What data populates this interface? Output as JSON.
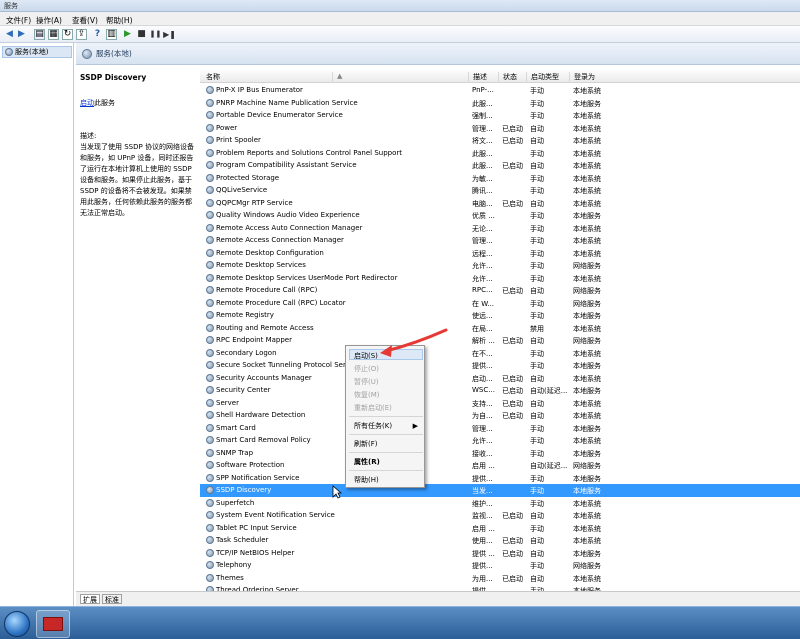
{
  "window": {
    "title": "服务"
  },
  "menu": [
    "文件(F)",
    "操作(A)",
    "查看(V)",
    "帮助(H)"
  ],
  "tree": {
    "item": "服务(本地)"
  },
  "header": {
    "title": "服务(本地)"
  },
  "detail": {
    "name": "SSDP Discovery",
    "start_link": "启动",
    "start_suffix": "此服务",
    "desc_label": "描述:",
    "desc_text": "当发现了使用 SSDP 协议的网络设备和服务，如 UPnP 设备，同时还报告了运行在本地计算机上使用的 SSDP 设备和服务。如果停止此服务，基于 SSDP 的设备将不会被发现。如果禁用此服务，任何依赖此服务的服务都无法正常启动。"
  },
  "columns": {
    "name": "名称",
    "desc": "描述",
    "status": "状态",
    "startup": "启动类型",
    "logon": "登录为"
  },
  "services": [
    {
      "name": "PnP-X IP Bus Enumerator",
      "desc": "PnP-...",
      "status": "",
      "startup": "手动",
      "logon": "本地系统"
    },
    {
      "name": "PNRP Machine Name Publication Service",
      "desc": "此服...",
      "status": "",
      "startup": "手动",
      "logon": "本地服务"
    },
    {
      "name": "Portable Device Enumerator Service",
      "desc": "强制...",
      "status": "",
      "startup": "手动",
      "logon": "本地系统"
    },
    {
      "name": "Power",
      "desc": "管理...",
      "status": "已启动",
      "startup": "自动",
      "logon": "本地系统"
    },
    {
      "name": "Print Spooler",
      "desc": "将文...",
      "status": "已启动",
      "startup": "自动",
      "logon": "本地系统"
    },
    {
      "name": "Problem Reports and Solutions Control Panel Support",
      "desc": "此服...",
      "status": "",
      "startup": "手动",
      "logon": "本地系统"
    },
    {
      "name": "Program Compatibility Assistant Service",
      "desc": "此服...",
      "status": "已启动",
      "startup": "自动",
      "logon": "本地系统"
    },
    {
      "name": "Protected Storage",
      "desc": "为敏...",
      "status": "",
      "startup": "手动",
      "logon": "本地系统"
    },
    {
      "name": "QQLiveService",
      "desc": "腾讯...",
      "status": "",
      "startup": "手动",
      "logon": "本地系统"
    },
    {
      "name": "QQPCMgr RTP Service",
      "desc": "电脑...",
      "status": "已启动",
      "startup": "自动",
      "logon": "本地系统"
    },
    {
      "name": "Quality Windows Audio Video Experience",
      "desc": "优质 ...",
      "status": "",
      "startup": "手动",
      "logon": "本地服务"
    },
    {
      "name": "Remote Access Auto Connection Manager",
      "desc": "无论...",
      "status": "",
      "startup": "手动",
      "logon": "本地系统"
    },
    {
      "name": "Remote Access Connection Manager",
      "desc": "管理...",
      "status": "",
      "startup": "手动",
      "logon": "本地系统"
    },
    {
      "name": "Remote Desktop Configuration",
      "desc": "远程...",
      "status": "",
      "startup": "手动",
      "logon": "本地系统"
    },
    {
      "name": "Remote Desktop Services",
      "desc": "允许...",
      "status": "",
      "startup": "手动",
      "logon": "网络服务"
    },
    {
      "name": "Remote Desktop Services UserMode Port Redirector",
      "desc": "允许...",
      "status": "",
      "startup": "手动",
      "logon": "本地系统"
    },
    {
      "name": "Remote Procedure Call (RPC)",
      "desc": "RPC...",
      "status": "已启动",
      "startup": "自动",
      "logon": "网络服务"
    },
    {
      "name": "Remote Procedure Call (RPC) Locator",
      "desc": "在 W...",
      "status": "",
      "startup": "手动",
      "logon": "网络服务"
    },
    {
      "name": "Remote Registry",
      "desc": "使远...",
      "status": "",
      "startup": "手动",
      "logon": "本地服务"
    },
    {
      "name": "Routing and Remote Access",
      "desc": "在局...",
      "status": "",
      "startup": "禁用",
      "logon": "本地系统"
    },
    {
      "name": "RPC Endpoint Mapper",
      "desc": "解析 ...",
      "status": "已启动",
      "startup": "自动",
      "logon": "网络服务"
    },
    {
      "name": "Secondary Logon",
      "desc": "在不...",
      "status": "",
      "startup": "手动",
      "logon": "本地系统"
    },
    {
      "name": "Secure Socket Tunneling Protocol Service",
      "desc": "提供...",
      "status": "",
      "startup": "手动",
      "logon": "本地服务"
    },
    {
      "name": "Security Accounts Manager",
      "desc": "启动...",
      "status": "已启动",
      "startup": "自动",
      "logon": "本地系统"
    },
    {
      "name": "Security Center",
      "desc": "WSC...",
      "status": "已启动",
      "startup": "自动(延迟...",
      "logon": "本地服务"
    },
    {
      "name": "Server",
      "desc": "支持...",
      "status": "已启动",
      "startup": "自动",
      "logon": "本地系统"
    },
    {
      "name": "Shell Hardware Detection",
      "desc": "为自...",
      "status": "已启动",
      "startup": "自动",
      "logon": "本地系统"
    },
    {
      "name": "Smart Card",
      "desc": "管理...",
      "status": "",
      "startup": "手动",
      "logon": "本地服务"
    },
    {
      "name": "Smart Card Removal Policy",
      "desc": "允许...",
      "status": "",
      "startup": "手动",
      "logon": "本地系统"
    },
    {
      "name": "SNMP Trap",
      "desc": "接收...",
      "status": "",
      "startup": "手动",
      "logon": "本地服务"
    },
    {
      "name": "Software Protection",
      "desc": "启用 ...",
      "status": "",
      "startup": "自动(延迟...",
      "logon": "网络服务"
    },
    {
      "name": "SPP Notification Service",
      "desc": "提供...",
      "status": "",
      "startup": "手动",
      "logon": "本地服务"
    },
    {
      "name": "SSDP Discovery",
      "desc": "当发...",
      "status": "",
      "startup": "手动",
      "logon": "本地服务",
      "selected": true
    },
    {
      "name": "Superfetch",
      "desc": "维护...",
      "status": "",
      "startup": "手动",
      "logon": "本地系统"
    },
    {
      "name": "System Event Notification Service",
      "desc": "监视...",
      "status": "已启动",
      "startup": "自动",
      "logon": "本地系统"
    },
    {
      "name": "Tablet PC Input Service",
      "desc": "启用 ...",
      "status": "",
      "startup": "手动",
      "logon": "本地系统"
    },
    {
      "name": "Task Scheduler",
      "desc": "使用...",
      "status": "已启动",
      "startup": "自动",
      "logon": "本地系统"
    },
    {
      "name": "TCP/IP NetBIOS Helper",
      "desc": "提供 ...",
      "status": "已启动",
      "startup": "自动",
      "logon": "本地服务"
    },
    {
      "name": "Telephony",
      "desc": "提供...",
      "status": "",
      "startup": "手动",
      "logon": "网络服务"
    },
    {
      "name": "Themes",
      "desc": "为用...",
      "status": "已启动",
      "startup": "自动",
      "logon": "本地系统"
    },
    {
      "name": "Thread Ordering Server",
      "desc": "提供...",
      "status": "",
      "startup": "手动",
      "logon": "本地服务"
    }
  ],
  "context_menu": {
    "start": "启动(S)",
    "stop": "停止(O)",
    "pause": "暂停(U)",
    "resume": "恢复(M)",
    "restart": "重新启动(E)",
    "all_tasks": "所有任务(K)",
    "refresh": "刷新(F)",
    "properties": "属性(R)",
    "help": "帮助(H)"
  },
  "bottom_tabs": [
    "扩展",
    "标准"
  ],
  "colors": {
    "selection": "#3399ff",
    "annotation_arrow": "#e53935",
    "link": "#0033cc"
  }
}
